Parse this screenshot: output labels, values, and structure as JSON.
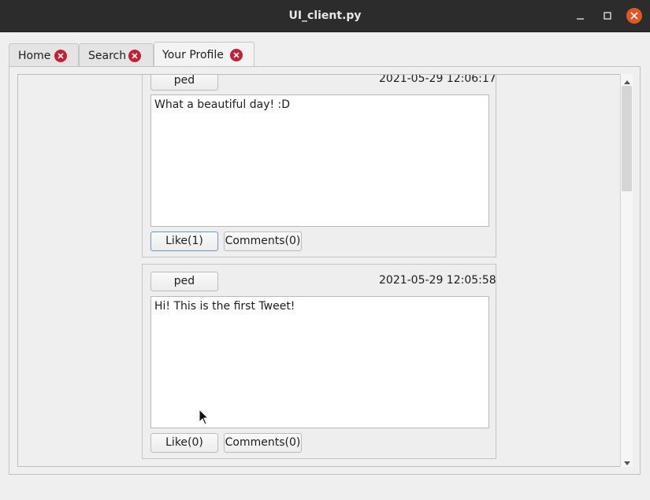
{
  "window": {
    "title": "UI_client.py"
  },
  "tabs": [
    {
      "label": "Home",
      "active": false
    },
    {
      "label": "Search",
      "active": false
    },
    {
      "label": "Your Profile",
      "active": true
    }
  ],
  "tweets": [
    {
      "author": "ped",
      "timestamp": "2021-05-29 12:06:17",
      "text": "What a beautiful day! :D",
      "like_label": "Like(1)",
      "comments_label": "Comments(0)"
    },
    {
      "author": "ped",
      "timestamp": "2021-05-29 12:05:58",
      "text": "Hi! This is the first Tweet!",
      "like_label": "Like(0)",
      "comments_label": "Comments(0)"
    }
  ],
  "icons": {
    "minimize": "minimize-icon",
    "maximize": "maximize-icon",
    "close": "close-icon",
    "tab_close": "tab-close-icon",
    "scroll_up": "chevron-up-icon",
    "scroll_down": "chevron-down-icon",
    "cursor": "mouse-pointer-icon"
  },
  "colors": {
    "titlebar": "#2c2c2c",
    "window_close": "#e2561f",
    "tab_close": "#c41f34",
    "focus_border": "#6e97c2"
  }
}
